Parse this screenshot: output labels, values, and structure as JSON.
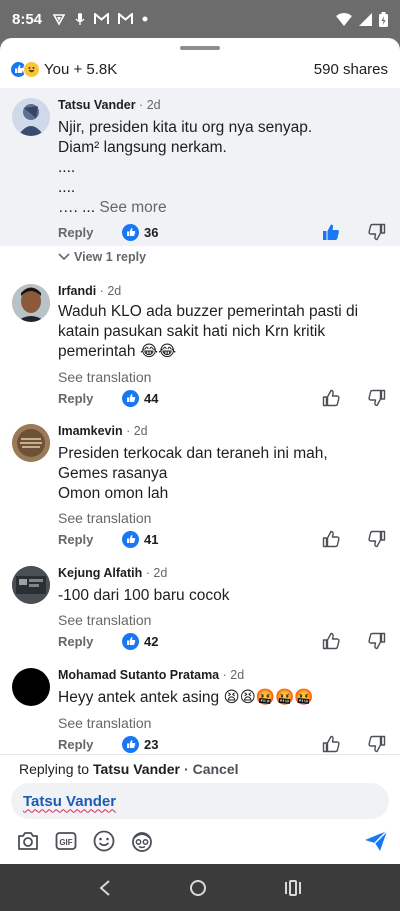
{
  "status_bar": {
    "time": "8:54",
    "notif_icons": [
      "vpn-icon",
      "mic-icon",
      "gmail-icon",
      "gmail-icon",
      "dot-icon"
    ]
  },
  "sheet": {
    "reaction_summary": "You + 5.8K",
    "shares": "590 shares"
  },
  "comments": [
    {
      "author": "Tatsu Vander",
      "time": "2d",
      "lines": [
        "Njir, presiden kita itu org nya senyap.",
        "Diam² langsung nerkam.",
        "....",
        "....",
        "…. ..."
      ],
      "see_more": "See more",
      "reply_label": "Reply",
      "likes": "36",
      "liked": true,
      "view_replies": "View 1 reply"
    },
    {
      "author": "Irfandi",
      "time": "2d",
      "lines": [
        "Waduh KLO ada buzzer pemerintah pasti di",
        "katain pasukan sakit hati nich Krn kritik",
        "pemerintah 😂😂"
      ],
      "see_translation": "See translation",
      "reply_label": "Reply",
      "likes": "44"
    },
    {
      "author": "Imamkevin",
      "time": "2d",
      "lines": [
        "Presiden terkocak dan teraneh ini mah,",
        "Gemes rasanya",
        "Omon omon lah"
      ],
      "see_translation": "See translation",
      "reply_label": "Reply",
      "likes": "41"
    },
    {
      "author": "Kejung Alfatih",
      "time": "2d",
      "lines": [
        "-100 dari 100 baru cocok"
      ],
      "see_translation": "See translation",
      "reply_label": "Reply",
      "likes": "42"
    },
    {
      "author": "Mohamad Sutanto Pratama",
      "time": "2d",
      "lines": [
        "Heyy antek antek asing 😫😫🤬🤬🤬"
      ],
      "see_translation": "See translation",
      "reply_label": "Reply",
      "likes": "23"
    }
  ],
  "compose": {
    "replying_prefix": "Replying to",
    "replying_to": "Tatsu Vander",
    "separator": "·",
    "cancel": "Cancel",
    "mention": "Tatsu Vander"
  },
  "colors": {
    "accent": "#1877f2",
    "highlight_bg": "#f0f2f5"
  }
}
